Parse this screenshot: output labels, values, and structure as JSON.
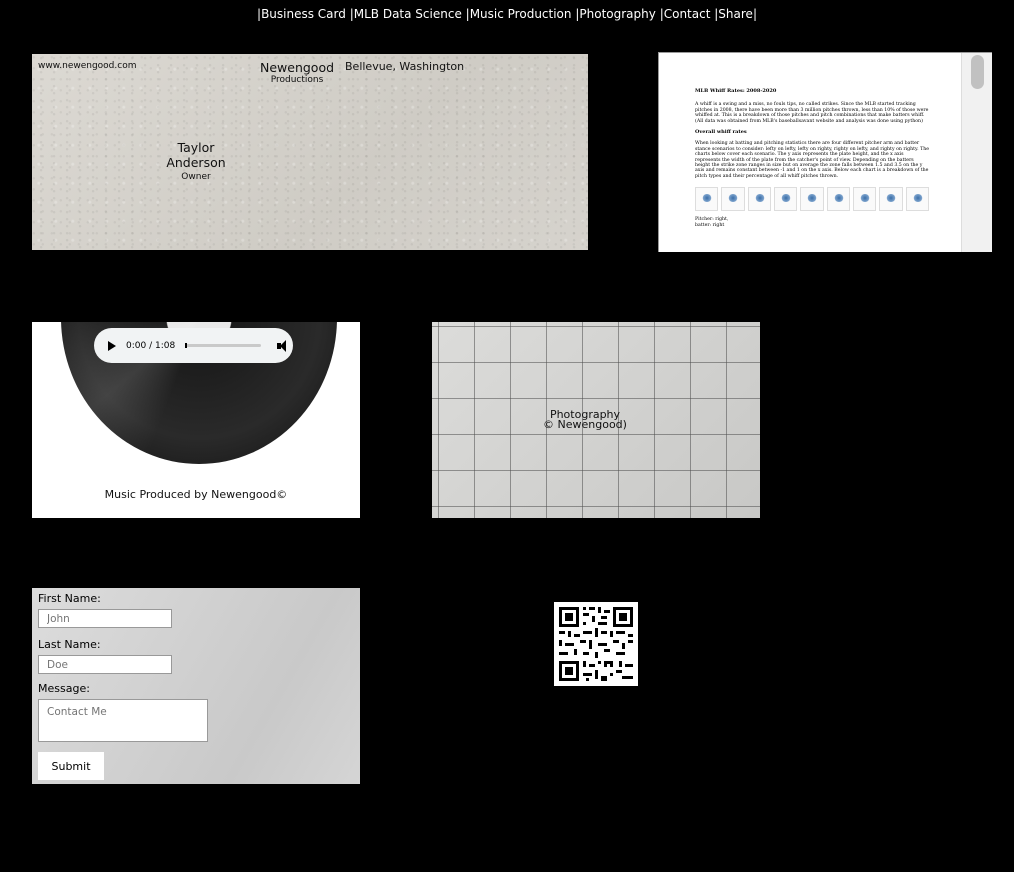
{
  "nav": {
    "items": [
      {
        "label": "Business Card"
      },
      {
        "label": "MLB Data Science"
      },
      {
        "label": "Music Production"
      },
      {
        "label": "Photography"
      },
      {
        "label": "Contact"
      },
      {
        "label": "Share"
      }
    ],
    "separator": "|"
  },
  "business_card": {
    "website": "www.newengood.com",
    "company": "Newengood",
    "company_sub": "Productions",
    "location": "Bellevue, Washington",
    "name": "Taylor Anderson",
    "title": "Owner"
  },
  "document": {
    "heading": "MLB Whiff Rates: 2008-2020",
    "p1": "A whiff is a swing and a miss, no fouls tips, no called strikes. Since the MLB started tracking pitches in 2008, there have been more than 3 million pitches thrown, less than 10% of those were whiffed at. This is a breakdown of those pitches and pitch combinations that make batters whiff. (All data was obtained from MLB's baseballsavant website and analysis was done using python)",
    "subheading": "Overall whiff rates",
    "p2": "When looking at batting and pitching statistics there are four different pitcher arm and batter stance scenarios to consider: lefty on lefty, lefty on righty, righty on lefty, and righty on righty. The charts below cover each scenario. The y axis represents the plate height, and the x axis represents the width of the plate from the catcher's point of view. Depending on the batters height the strike zone ranges in size but on average the zone falls between 1.5 and 3.5 on the y axis and remains constant between -1 and 1 on the x axis. Below each chart is a breakdown of the pitch types and their percentage of all whiff pitches thrown.",
    "footer1": "Pitcher: right,",
    "footer2": "batter: right"
  },
  "music": {
    "time": "0:00 / 1:08",
    "caption": "Music Produced by Newengood©"
  },
  "photography": {
    "line1": "Photography",
    "line2": "© Newengood)"
  },
  "contact": {
    "first_label": "First Name:",
    "first_placeholder": "John",
    "last_label": "Last Name:",
    "last_placeholder": "Doe",
    "message_label": "Message:",
    "message_placeholder": "Contact Me",
    "submit": "Submit"
  },
  "colors": {
    "background": "#000000",
    "text": "#ffffff"
  }
}
